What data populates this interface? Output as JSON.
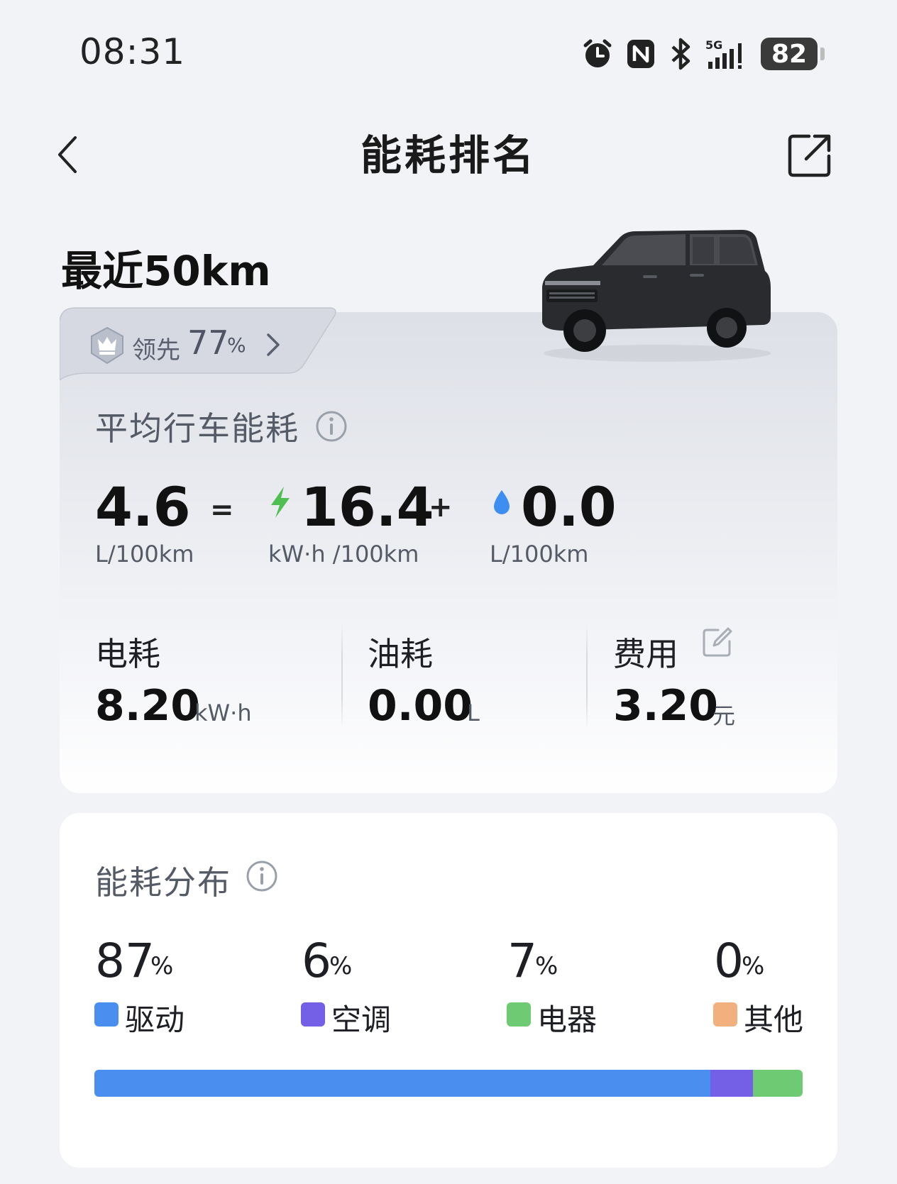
{
  "status_bar": {
    "time": "08:31",
    "battery": "82"
  },
  "header": {
    "title": "能耗排名"
  },
  "section": {
    "title": "最近50km"
  },
  "rank": {
    "label": "领先",
    "value": "77",
    "unit": "%"
  },
  "avg": {
    "title": "平均行车能耗",
    "total_value": "4.6",
    "total_unit": "L/100km",
    "eq": "=",
    "elec_value": "16.4",
    "elec_unit": "kW·h /100km",
    "plus": "+",
    "fuel_value": "0.0",
    "fuel_unit": "L/100km"
  },
  "stats": [
    {
      "label": "电耗",
      "value": "8.20",
      "unit": "kW·h"
    },
    {
      "label": "油耗",
      "value": "0.00",
      "unit": "L"
    },
    {
      "label": "费用",
      "value": "3.20",
      "unit": "元"
    }
  ],
  "distribution": {
    "title": "能耗分布",
    "pct_sign": "%",
    "items": [
      {
        "percent": "87",
        "label": "驱动",
        "color": "#4a8ef0",
        "share": 87
      },
      {
        "percent": "6",
        "label": "空调",
        "color": "#7460e6",
        "share": 6
      },
      {
        "percent": "7",
        "label": "电器",
        "color": "#6ecb74",
        "share": 7
      },
      {
        "percent": "0",
        "label": "其他",
        "color": "#f2b07f",
        "share": 0
      }
    ]
  },
  "colors": {
    "accent_green": "#4fbf52",
    "accent_blue": "#3d8ef0"
  },
  "icons": [
    "alarm-icon",
    "nfc-icon",
    "bluetooth-icon",
    "signal-5g-icon",
    "battery-icon",
    "back-icon",
    "share-icon",
    "crown-icon",
    "chevron-right-icon",
    "info-icon",
    "bolt-icon",
    "droplet-icon",
    "edit-icon"
  ]
}
